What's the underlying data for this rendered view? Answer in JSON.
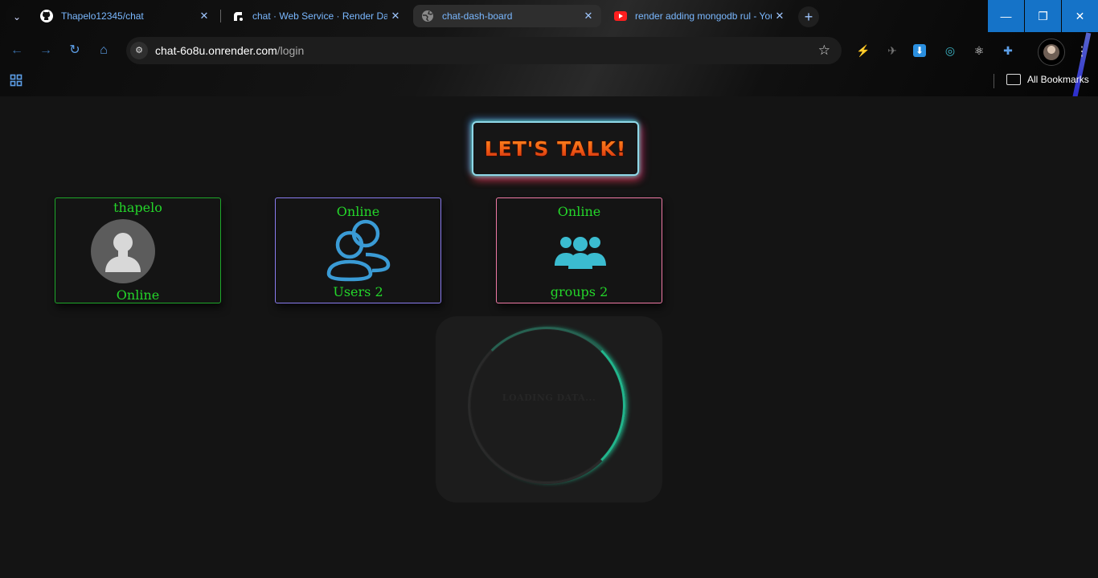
{
  "browser": {
    "tabs": [
      {
        "title": "Thapelo12345/chat",
        "icon": "github-icon"
      },
      {
        "title": "chat · Web Service · Render Dashboard",
        "icon": "render-icon"
      },
      {
        "title": "chat-dash-board",
        "icon": "globe-icon",
        "active": true
      },
      {
        "title": "render adding mongodb rul - YouTube",
        "icon": "youtube-icon"
      }
    ],
    "address": {
      "host": "chat-6o8u.onrender.com",
      "path": "/login"
    },
    "bookmarks": {
      "all_label": "All Bookmarks"
    }
  },
  "page": {
    "logo_text": "LET'S TALK!",
    "user_card": {
      "name": "thapelo",
      "status": "Online"
    },
    "users_card": {
      "status": "Online",
      "label": "Users 2"
    },
    "groups_card": {
      "status": "Online",
      "label": "groups 2"
    },
    "loader": {
      "text": "LOADING DATA..."
    }
  },
  "colors": {
    "accent_green": "#24d62a",
    "users_border": "#8a7cf0",
    "groups_border": "#f07aa6",
    "icon_blue": "#3a9bd5",
    "icon_teal": "#3bbcd0"
  }
}
